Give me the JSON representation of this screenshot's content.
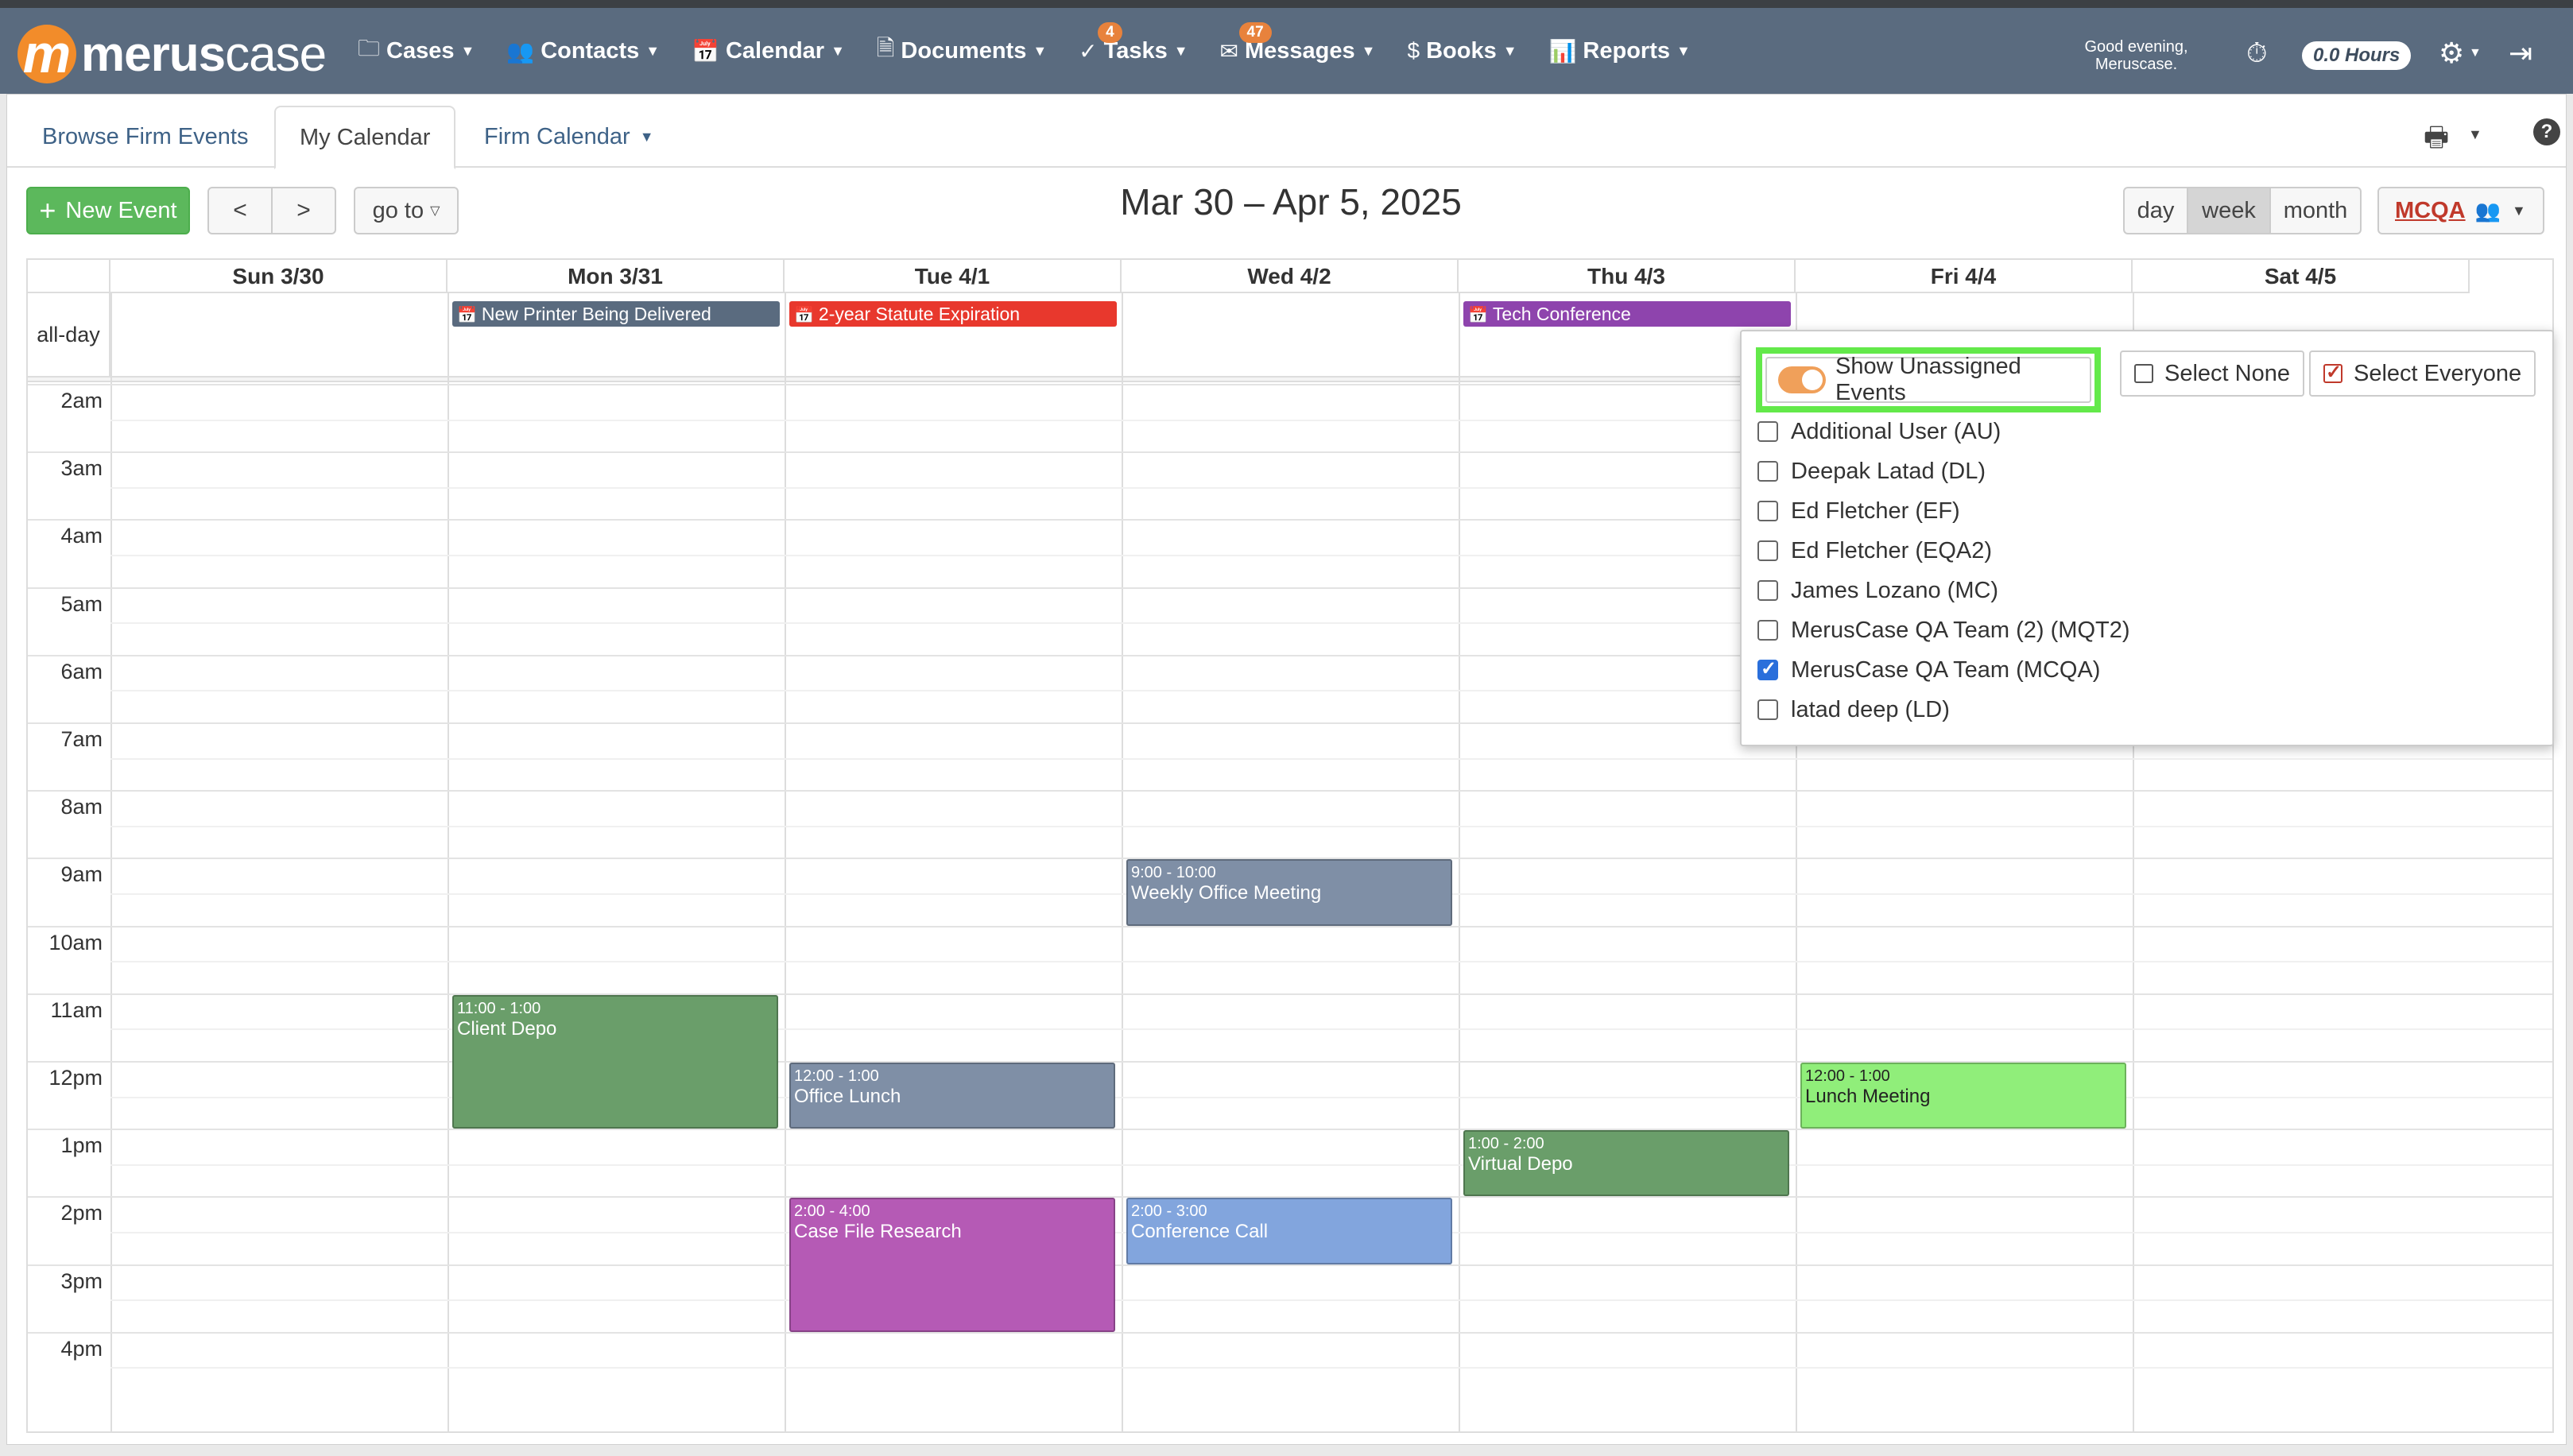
{
  "brand": {
    "mark": "m",
    "name_bold": "merus",
    "name_light": "case"
  },
  "nav": [
    {
      "icon": "🗀",
      "label": "Cases",
      "badge": ""
    },
    {
      "icon": "👥",
      "label": "Contacts",
      "badge": ""
    },
    {
      "icon": "📅",
      "label": "Calendar",
      "badge": ""
    },
    {
      "icon": "🗎",
      "label": "Documents",
      "badge": ""
    },
    {
      "icon": "✓",
      "label": "Tasks",
      "badge": "4"
    },
    {
      "icon": "✉",
      "label": "Messages",
      "badge": "47"
    },
    {
      "icon": "$",
      "label": "Books",
      "badge": ""
    },
    {
      "icon": "📊",
      "label": "Reports",
      "badge": ""
    }
  ],
  "header": {
    "greeting_line1": "Good evening,",
    "greeting_line2": "Meruscase.",
    "hours": "0.0 Hours"
  },
  "tabs": {
    "browse": "Browse Firm Events",
    "my": "My Calendar",
    "firm": "Firm Calendar"
  },
  "toolbar": {
    "new_event": "New Event",
    "prev": "<",
    "next": ">",
    "goto": "go to",
    "title": "Mar 30 – Apr 5, 2025",
    "view_day": "day",
    "view_week": "week",
    "view_month": "month",
    "active_view": "week",
    "user_code": "MCQA"
  },
  "calendar": {
    "days": [
      "Sun 3/30",
      "Mon 3/31",
      "Tue 4/1",
      "Wed 4/2",
      "Thu 4/3",
      "Fri 4/4",
      "Sat 4/5"
    ],
    "allday_label": "all-day",
    "hours": [
      "2am",
      "3am",
      "4am",
      "5am",
      "6am",
      "7am",
      "8am",
      "9am",
      "10am",
      "11am",
      "12pm",
      "1pm",
      "2pm",
      "3pm",
      "4pm"
    ],
    "allday_events": [
      {
        "day": 1,
        "name": "New Printer Being Delivered",
        "color": "#5a6b7f"
      },
      {
        "day": 2,
        "name": "2-year Statute Expiration",
        "color": "#e8382d"
      },
      {
        "day": 4,
        "name": "Tech Conference",
        "color": "#8e44ad"
      }
    ],
    "events": [
      {
        "day": 3,
        "start": 9,
        "end": 10,
        "time": "9:00 - 10:00",
        "name": "Weekly Office Meeting",
        "color": "#7f8fa6",
        "text": "#fff"
      },
      {
        "day": 1,
        "start": 11,
        "end": 13,
        "time": "11:00 - 1:00",
        "name": "Client Depo",
        "color": "#6a9e6a",
        "text": "#fff"
      },
      {
        "day": 2,
        "start": 12,
        "end": 13,
        "time": "12:00 - 1:00",
        "name": "Office Lunch",
        "color": "#7f8fa6",
        "text": "#fff"
      },
      {
        "day": 5,
        "start": 12,
        "end": 13,
        "time": "12:00 - 1:00",
        "name": "Lunch Meeting",
        "color": "#90ee7a",
        "text": "#222"
      },
      {
        "day": 4,
        "start": 13,
        "end": 14,
        "time": "1:00 - 2:00",
        "name": "Virtual Depo",
        "color": "#6a9e6a",
        "text": "#fff"
      },
      {
        "day": 2,
        "start": 14,
        "end": 16,
        "time": "2:00 - 4:00",
        "name": "Case File Research",
        "color": "#b55ab5",
        "text": "#fff"
      },
      {
        "day": 3,
        "start": 14,
        "end": 15,
        "time": "2:00 - 3:00",
        "name": "Conference Call",
        "color": "#82a5dd",
        "text": "#fff"
      }
    ]
  },
  "user_filter": {
    "show_unassigned": "Show Unassigned Events",
    "select_none": "Select None",
    "select_everyone": "Select Everyone",
    "users": [
      {
        "label": "Additional User (AU)",
        "checked": false
      },
      {
        "label": "Deepak Latad (DL)",
        "checked": false
      },
      {
        "label": "Ed Fletcher (EF)",
        "checked": false
      },
      {
        "label": "Ed Fletcher (EQA2)",
        "checked": false
      },
      {
        "label": "James Lozano (MC)",
        "checked": false
      },
      {
        "label": "MerusCase QA Team (2) (MQT2)",
        "checked": false
      },
      {
        "label": "MerusCase QA Team (MCQA)",
        "checked": true
      },
      {
        "label": "latad deep (LD)",
        "checked": false
      }
    ]
  }
}
